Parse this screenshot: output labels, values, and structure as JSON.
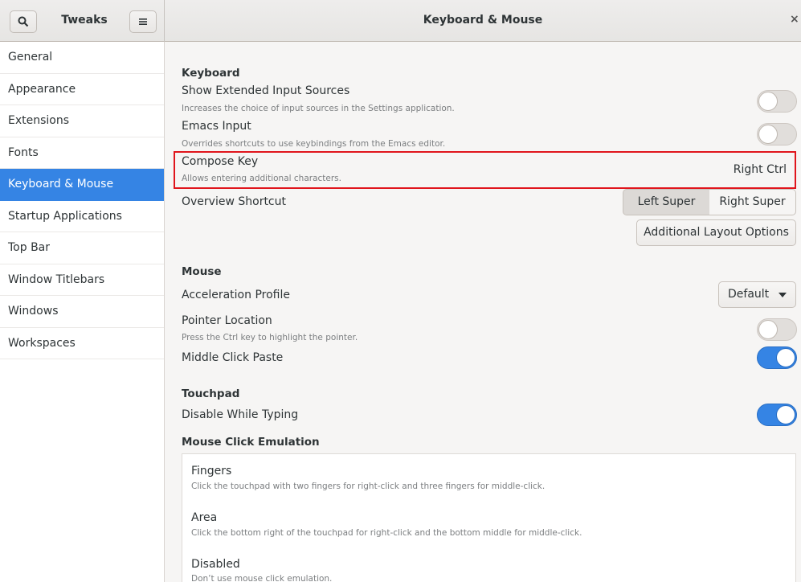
{
  "header": {
    "app_title": "Tweaks",
    "page_title": "Keyboard & Mouse",
    "close_glyph": "×",
    "search_icon": "search-icon",
    "menu_icon": "hamburger-menu-icon"
  },
  "sidebar": {
    "items": [
      {
        "label": "General"
      },
      {
        "label": "Appearance"
      },
      {
        "label": "Extensions"
      },
      {
        "label": "Fonts"
      },
      {
        "label": "Keyboard & Mouse",
        "active": true
      },
      {
        "label": "Startup Applications"
      },
      {
        "label": "Top Bar"
      },
      {
        "label": "Window Titlebars"
      },
      {
        "label": "Windows"
      },
      {
        "label": "Workspaces"
      }
    ]
  },
  "keyboard": {
    "section_title": "Keyboard",
    "extended_sources": {
      "title": "Show Extended Input Sources",
      "desc": "Increases the choice of input sources in the Settings application.",
      "enabled": false
    },
    "emacs_input": {
      "title": "Emacs Input",
      "desc": "Overrides shortcuts to use keybindings from the Emacs editor.",
      "enabled": false
    },
    "compose_key": {
      "title": "Compose Key",
      "desc": "Allows entering additional characters.",
      "value": "Right Ctrl"
    },
    "overview_shortcut": {
      "title": "Overview Shortcut",
      "options": [
        "Left Super",
        "Right Super"
      ],
      "selected": "Left Super"
    },
    "additional_layout_button": "Additional Layout Options"
  },
  "mouse": {
    "section_title": "Mouse",
    "acceleration_profile": {
      "title": "Acceleration Profile",
      "value": "Default"
    },
    "pointer_location": {
      "title": "Pointer Location",
      "desc": "Press the Ctrl key to highlight the pointer.",
      "enabled": false
    },
    "middle_click_paste": {
      "title": "Middle Click Paste",
      "enabled": true
    }
  },
  "touchpad": {
    "section_title": "Touchpad",
    "disable_while_typing": {
      "title": "Disable While Typing",
      "enabled": true
    }
  },
  "click_emulation": {
    "section_title": "Mouse Click Emulation",
    "options": [
      {
        "title": "Fingers",
        "desc": "Click the touchpad with two fingers for right-click and three fingers for middle-click."
      },
      {
        "title": "Area",
        "desc": "Click the bottom right of the touchpad for right-click and the bottom middle for middle-click."
      },
      {
        "title": "Disabled",
        "desc": "Don’t use mouse click emulation."
      }
    ]
  }
}
